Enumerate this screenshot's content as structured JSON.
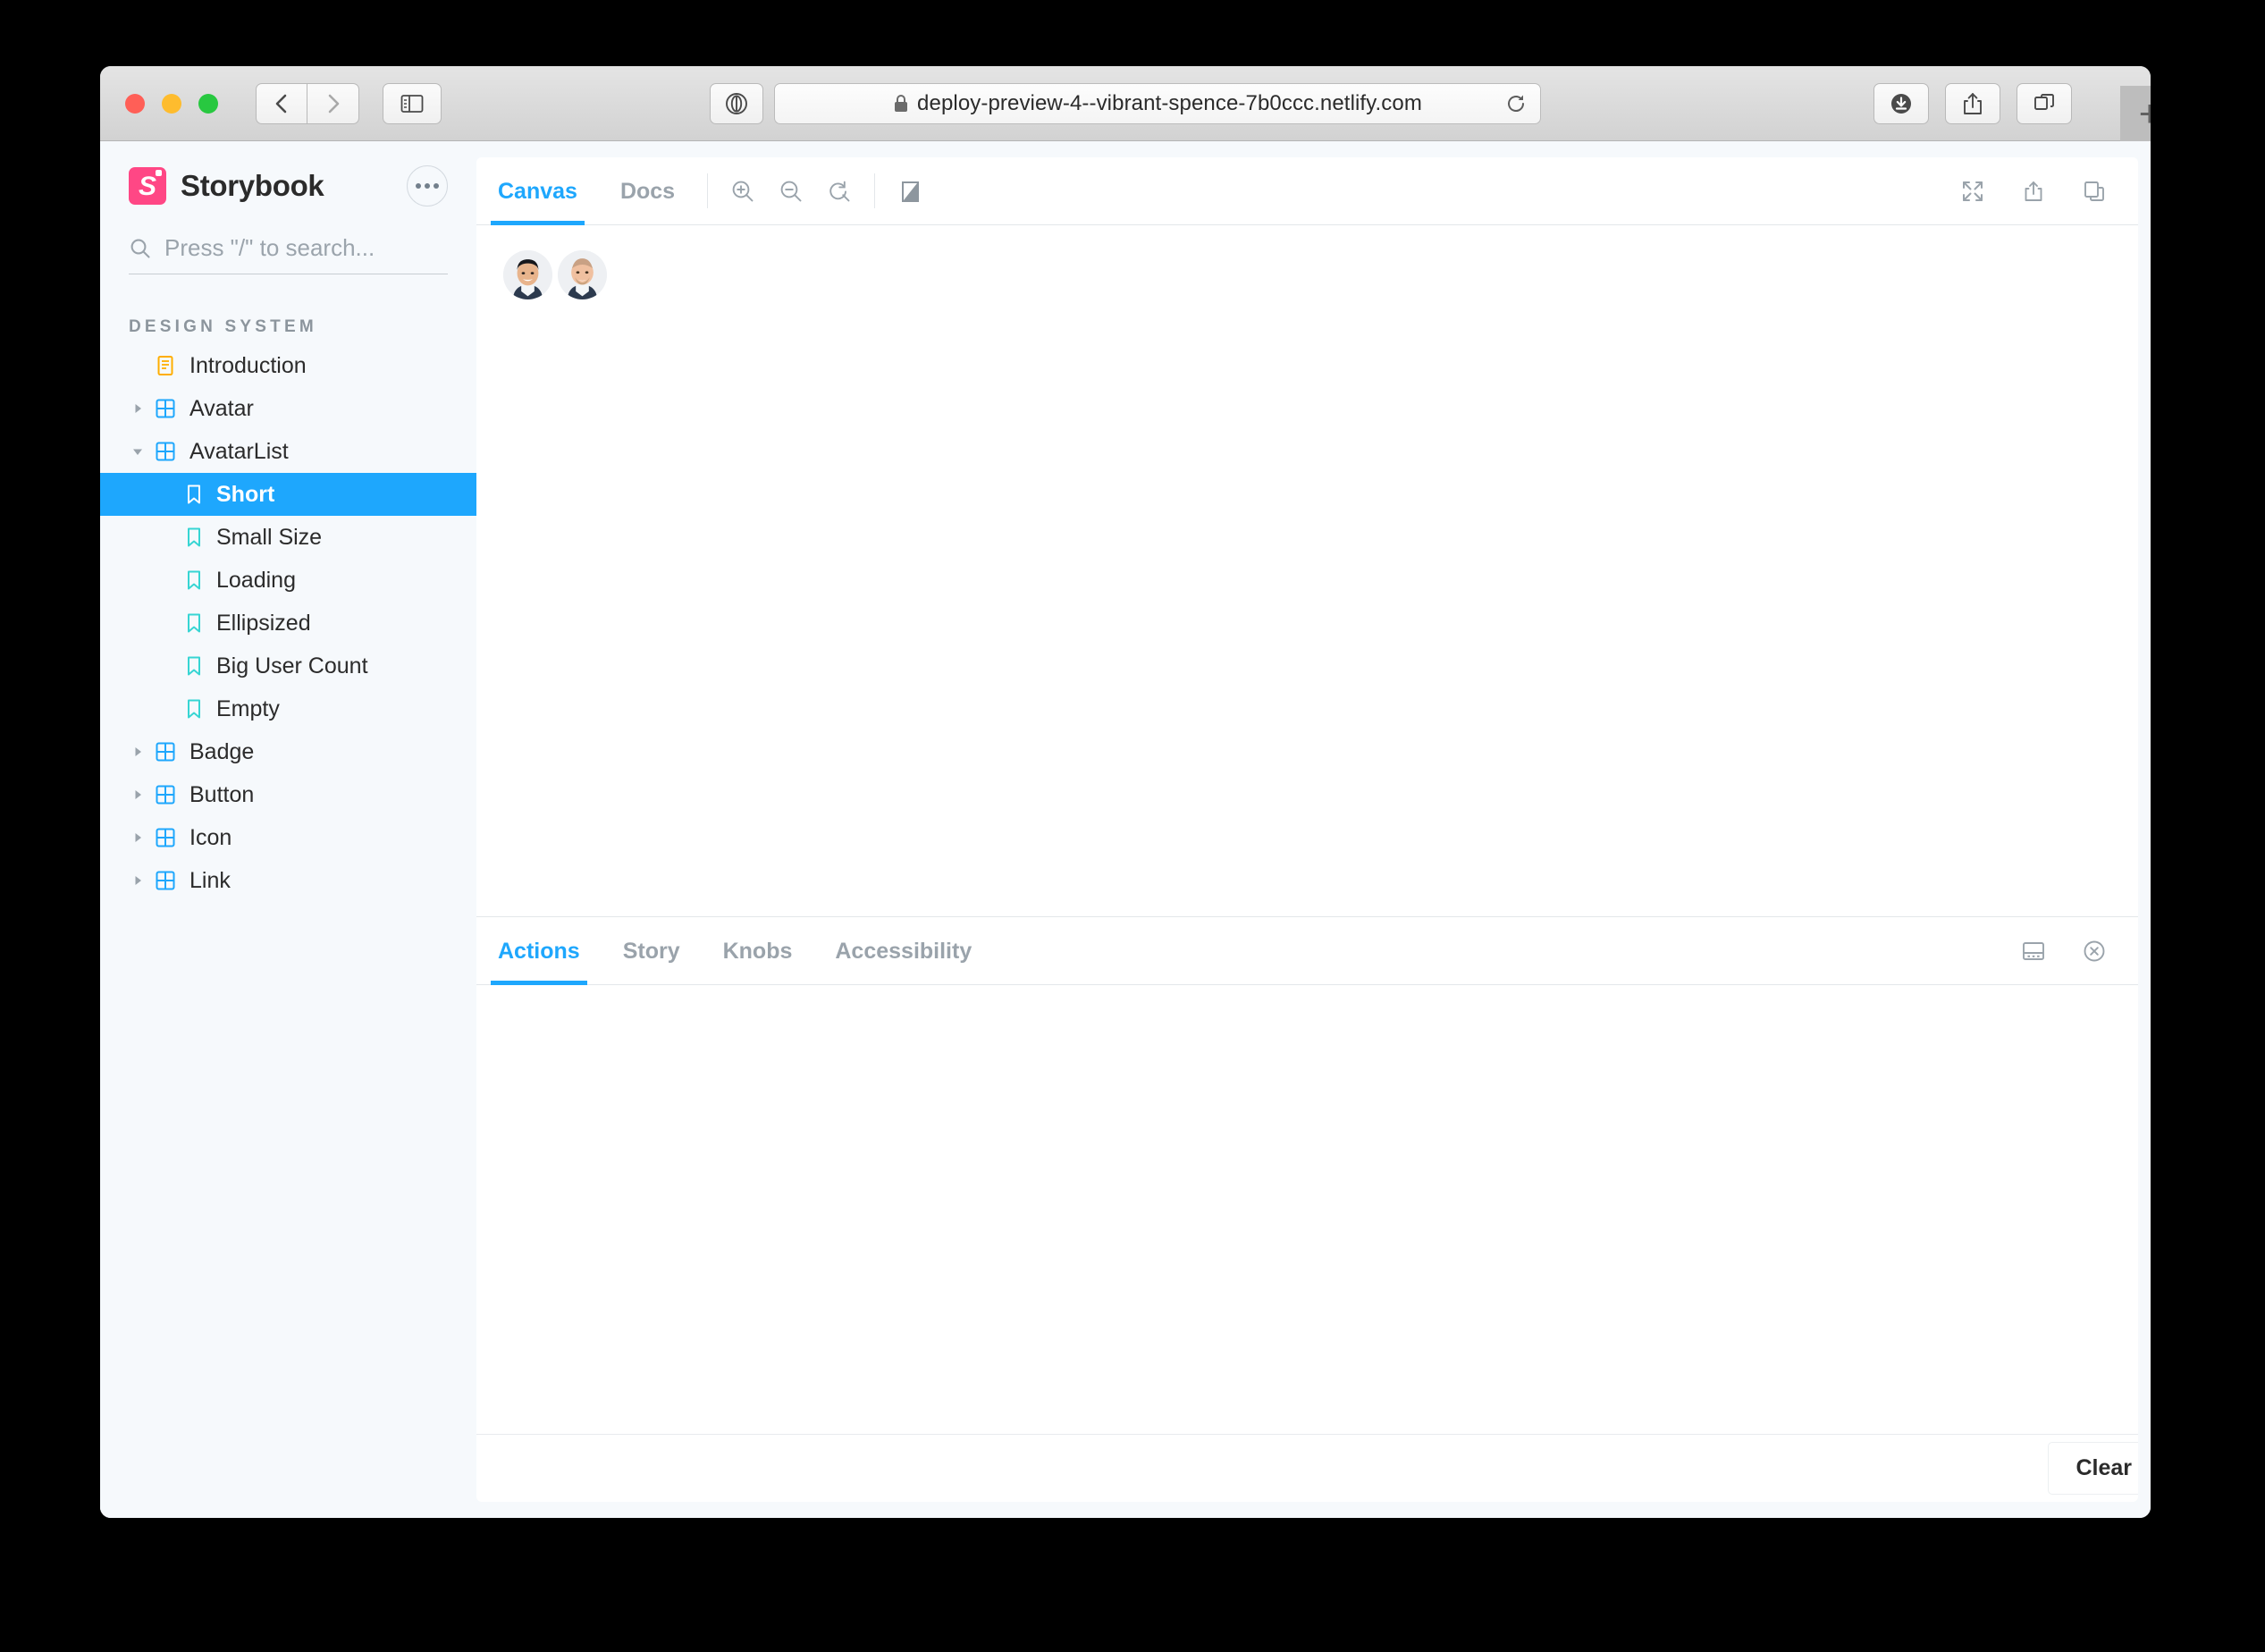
{
  "browser": {
    "url": "deploy-preview-4--vibrant-spence-7b0ccc.netlify.com",
    "back_label": "‹",
    "forward_label": "›",
    "new_tab_label": "+",
    "icons": {
      "sidebar": "sidebar-toggle-icon",
      "reader": "reader-mode-icon",
      "lock": "lock-icon",
      "reload": "reload-icon",
      "download": "download-icon",
      "share": "share-icon",
      "tabs": "tab-overview-icon"
    },
    "traffic_lights": [
      "close",
      "minimize",
      "zoom"
    ]
  },
  "sidebar": {
    "brand": "Storybook",
    "logo_letter": "S",
    "menu_label": "•••",
    "search": {
      "placeholder": "Press \"/\" to search...",
      "value": ""
    },
    "group_title": "DESIGN SYSTEM",
    "items": [
      {
        "label": "Introduction",
        "type": "doc",
        "depth": 0,
        "expandable": false,
        "expanded": false,
        "selected": false
      },
      {
        "label": "Avatar",
        "type": "component",
        "depth": 0,
        "expandable": true,
        "expanded": false,
        "selected": false
      },
      {
        "label": "AvatarList",
        "type": "component",
        "depth": 0,
        "expandable": true,
        "expanded": true,
        "selected": false
      },
      {
        "label": "Short",
        "type": "story",
        "depth": 1,
        "expandable": false,
        "expanded": false,
        "selected": true
      },
      {
        "label": "Small Size",
        "type": "story",
        "depth": 1,
        "expandable": false,
        "expanded": false,
        "selected": false
      },
      {
        "label": "Loading",
        "type": "story",
        "depth": 1,
        "expandable": false,
        "expanded": false,
        "selected": false
      },
      {
        "label": "Ellipsized",
        "type": "story",
        "depth": 1,
        "expandable": false,
        "expanded": false,
        "selected": false
      },
      {
        "label": "Big User Count",
        "type": "story",
        "depth": 1,
        "expandable": false,
        "expanded": false,
        "selected": false
      },
      {
        "label": "Empty",
        "type": "story",
        "depth": 1,
        "expandable": false,
        "expanded": false,
        "selected": false
      },
      {
        "label": "Badge",
        "type": "component",
        "depth": 0,
        "expandable": true,
        "expanded": false,
        "selected": false
      },
      {
        "label": "Button",
        "type": "component",
        "depth": 0,
        "expandable": true,
        "expanded": false,
        "selected": false
      },
      {
        "label": "Icon",
        "type": "component",
        "depth": 0,
        "expandable": true,
        "expanded": false,
        "selected": false
      },
      {
        "label": "Link",
        "type": "component",
        "depth": 0,
        "expandable": true,
        "expanded": false,
        "selected": false
      }
    ]
  },
  "preview": {
    "tabs": [
      {
        "label": "Canvas",
        "active": true
      },
      {
        "label": "Docs",
        "active": false
      }
    ],
    "tools": [
      "zoom-in-icon",
      "zoom-out-icon",
      "zoom-reset-icon",
      "background-grid-icon"
    ],
    "right_tools": [
      "fullscreen-icon",
      "open-in-new-icon",
      "copy-link-icon"
    ],
    "canvas": {
      "avatar_count": 2,
      "avatars": [
        "user-avatar-1",
        "user-avatar-2"
      ]
    }
  },
  "addons_panel": {
    "tabs": [
      {
        "label": "Actions",
        "active": true
      },
      {
        "label": "Story",
        "active": false
      },
      {
        "label": "Knobs",
        "active": false
      },
      {
        "label": "Accessibility",
        "active": false
      }
    ],
    "right_tools": [
      "panel-position-icon",
      "close-panel-icon"
    ],
    "clear_label": "Clear",
    "content": ""
  },
  "colors": {
    "brand_blue": "#1ea7fd",
    "storybook_pink": "#ff4785",
    "sidebar_bg": "#f6f9fc",
    "story_icon": "#37d5d3",
    "doc_icon": "#ffae00",
    "component_icon": "#1ea7fd"
  }
}
